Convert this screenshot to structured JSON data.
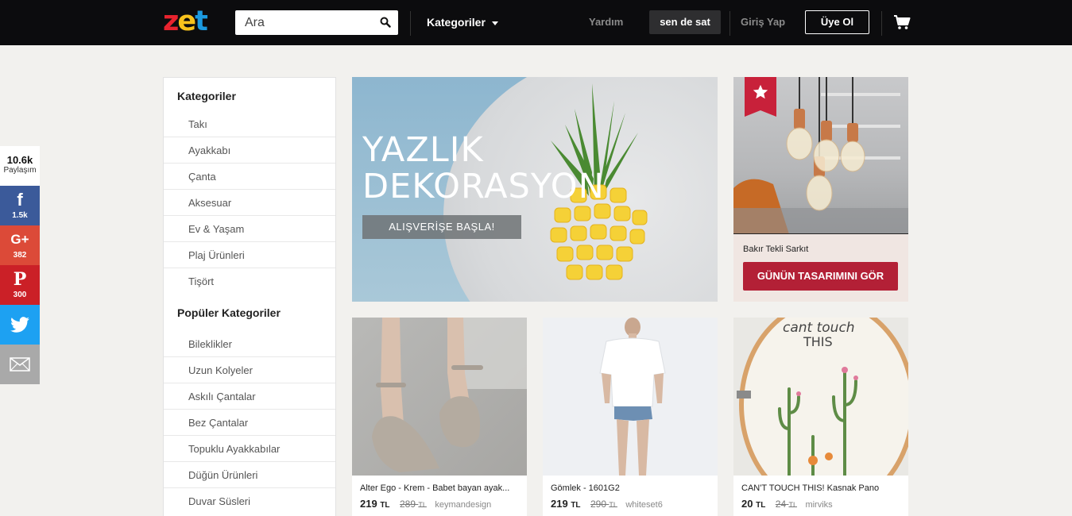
{
  "header": {
    "logo": [
      "z",
      "e",
      "t"
    ],
    "logo_colors": [
      "#e8232e",
      "#f7c21c",
      "#1b9ae0"
    ],
    "search_placeholder": "Ara",
    "categories_label": "Kategoriler",
    "help_label": "Yardım",
    "sell_label": "sen de sat",
    "login_label": "Giriş Yap",
    "signup_label": "Üye Ol"
  },
  "social": {
    "total": "10.6k",
    "total_label": "Paylaşım",
    "facebook": "1.5k",
    "google_plus": "382",
    "pinterest": "300",
    "colors": {
      "facebook": "#3b5a9a",
      "google_plus": "#dc4a38",
      "pinterest": "#cb2027",
      "twitter": "#1da1f2",
      "email": "#a9a9a9"
    }
  },
  "sidebar": {
    "categories_title": "Kategoriler",
    "categories": [
      "Takı",
      "Ayakkabı",
      "Çanta",
      "Aksesuar",
      "Ev & Yaşam",
      "Plaj Ürünleri",
      "Tişört"
    ],
    "popular_title": "Popüler Kategoriler",
    "popular": [
      "Bileklikler",
      "Uzun Kolyeler",
      "Askılı Çantalar",
      "Bez Çantalar",
      "Topuklu Ayakkabılar",
      "Düğün Ürünleri",
      "Duvar Süsleri"
    ]
  },
  "hero": {
    "title_line1": "YAZLIK",
    "title_line2": "DEKORASYON",
    "cta": "ALIŞVERİŞE BAŞLA!"
  },
  "daily": {
    "product_name": "Bakır Tekli Sarkıt",
    "button": "GÜNÜN TASARIMINI GÖR",
    "accent": "#b32036"
  },
  "products": [
    {
      "name": "Alter Ego - Krem - Babet bayan ayak...",
      "price": "219",
      "old_price": "289",
      "currency": "TL",
      "seller": "keymandesign"
    },
    {
      "name": "Gömlek - 1601G2",
      "price": "219",
      "old_price": "290",
      "currency": "TL",
      "seller": "whiteset6"
    },
    {
      "name": "CAN'T TOUCH THIS! Kasnak Pano",
      "price": "20",
      "old_price": "24",
      "currency": "TL",
      "seller": "mirviks"
    }
  ],
  "hoop_text": [
    "cant touch",
    "THIS"
  ]
}
